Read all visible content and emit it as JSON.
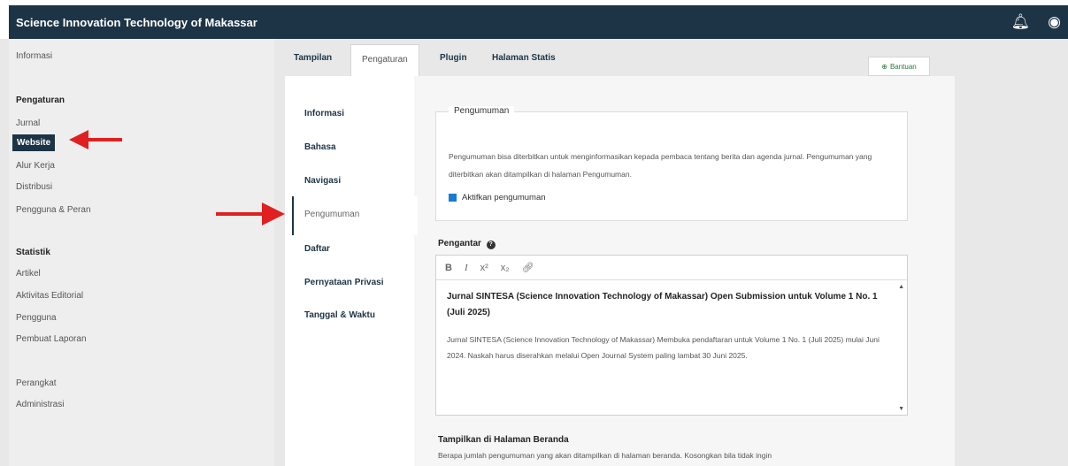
{
  "header": {
    "title": "Science Innovation Technology of Makassar",
    "bell_icon": "bell-icon",
    "user_icon": "user-circle-icon"
  },
  "sidebar": {
    "top_link": "Informasi",
    "section1": "Pengaturan",
    "items1": [
      "Jurnal",
      "Website",
      "Alur Kerja",
      "Distribusi",
      "Pengguna & Peran"
    ],
    "section2": "Statistik",
    "items2": [
      "Artikel",
      "Aktivitas Editorial",
      "Pengguna",
      "Pembuat Laporan"
    ],
    "section3_items": [
      "Perangkat",
      "Administrasi"
    ]
  },
  "tabs": [
    "Tampilan",
    "Pengaturan",
    "Plugin",
    "Halaman Statis"
  ],
  "help_button": "Bantuan",
  "subnav": [
    "Informasi",
    "Bahasa",
    "Navigasi",
    "Pengumuman",
    "Daftar",
    "Pernyataan Privasi",
    "Tanggal & Waktu"
  ],
  "announcements": {
    "legend": "Pengumuman",
    "description": "Pengumuman bisa diterbitkan untuk menginformasikan kepada pembaca tentang berita dan agenda jurnal. Pengumuman yang diterbitkan akan ditampilkan di halaman Pengumuman.",
    "checkbox_label": "Aktifkan pengumuman",
    "checkbox_checked": true
  },
  "intro": {
    "label": "Pengantar",
    "toolbar": [
      "B",
      "I",
      "x²",
      "x₂",
      "🔗"
    ],
    "title": "Jurnal SINTESA (Science Innovation Technology of Makassar) Open Submission untuk Volume 1 No. 1 (Juli 2025)",
    "body": "Jurnal SINTESA (Science Innovation Technology of Makassar) Membuka pendaftaran untuk Volume 1 No. 1 (Juli 2025) mulai Juni 2024. Naskah harus diserahkan melalui Open Journal System paling lambat 30 Juni 2025."
  },
  "homepage": {
    "label": "Tampilkan di Halaman Beranda",
    "description": "Berapa jumlah pengumuman yang akan ditampilkan di halaman beranda. Kosongkan bila tidak ingin"
  },
  "colors": {
    "header_bg": "#1d3446",
    "arrow": "#e02020",
    "checkbox": "#1a7bd1"
  }
}
